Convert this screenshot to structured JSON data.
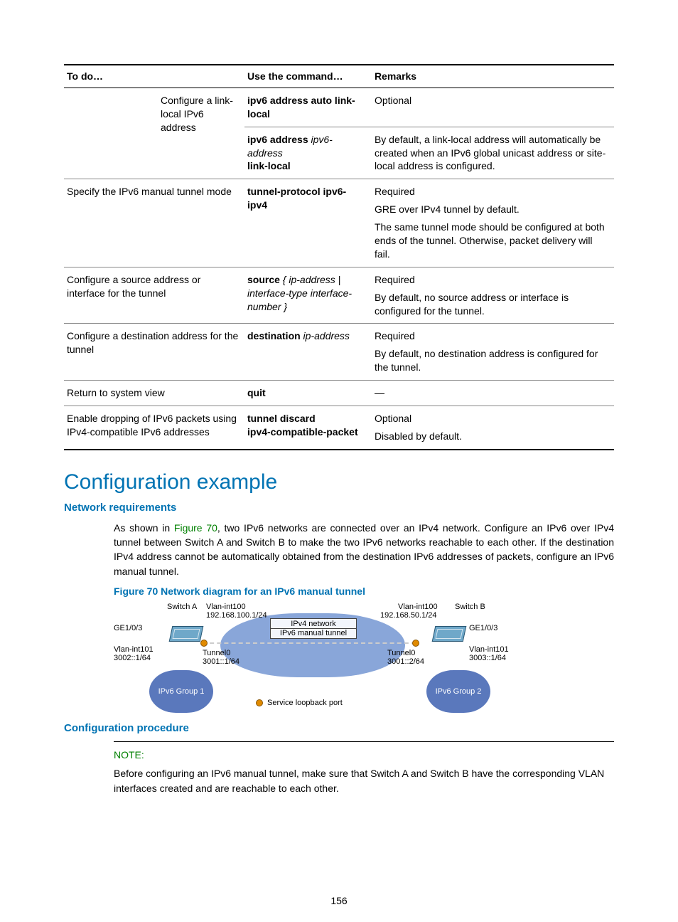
{
  "table": {
    "headers": {
      "h1": "To do…",
      "h2": "Use the command…",
      "h3": "Remarks"
    },
    "rows": {
      "r1a": {
        "todo": "Configure a link-local IPv6 address",
        "cmd": "ipv6 address auto link-local",
        "rem": "Optional"
      },
      "r1b": {
        "cmd_b": "ipv6 address",
        "cmd_i": " ipv6-address",
        "cmd_b2": " link-local",
        "rem": "By default, a link-local address will automatically be created when an IPv6 global unicast address or site-local address is configured."
      },
      "r2": {
        "todo": "Specify the IPv6 manual tunnel mode",
        "cmd": "tunnel-protocol ipv6-ipv4",
        "rem1": "Required",
        "rem2": "GRE over IPv4 tunnel by default.",
        "rem3": "The same tunnel mode should be configured at both ends of the tunnel. Otherwise, packet delivery will fail."
      },
      "r3": {
        "todo": "Configure a source address or interface for the tunnel",
        "cmd_b": "source",
        "cmd_rest": " { ip-address | interface-type interface-number }",
        "rem1": "Required",
        "rem2": "By default, no source address or interface is configured for the tunnel."
      },
      "r4": {
        "todo": "Configure a destination address for the tunnel",
        "cmd_b": "destination",
        "cmd_i": " ip-address",
        "rem1": "Required",
        "rem2": "By default, no destination address is configured for the tunnel."
      },
      "r5": {
        "todo": "Return to system view",
        "cmd": "quit",
        "rem": "—"
      },
      "r6": {
        "todo": "Enable dropping of IPv6 packets using IPv4-compatible IPv6 addresses",
        "cmd_l1": "tunnel discard",
        "cmd_l2": "ipv4-compatible-packet",
        "rem1": "Optional",
        "rem2": "Disabled by default."
      }
    }
  },
  "section": {
    "title": "Configuration example",
    "netreq_title": "Network requirements",
    "para_pre": "As shown in ",
    "para_figref": "Figure 70",
    "para_post": ", two IPv6 networks are connected over an IPv4 network. Configure an IPv6 over IPv4 tunnel between Switch A and Switch B to make the two IPv6 networks reachable to each other. If the destination IPv4 address cannot be automatically obtained from the destination IPv6 addresses of packets, configure an IPv6 manual tunnel.",
    "fig_caption": "Figure 70 Network diagram for an IPv6 manual tunnel",
    "confproc_title": "Configuration procedure",
    "note_title": "NOTE:",
    "note_body": "Before configuring an IPv6 manual tunnel, make sure that Switch A and Switch B have the corresponding VLAN interfaces created and are reachable to each other."
  },
  "diagram": {
    "switch_a": "Switch A",
    "switch_b": "Switch B",
    "vlan100a": "Vlan-int100",
    "vlan100a_ip": "192.168.100.1/24",
    "vlan100b": "Vlan-int100",
    "vlan100b_ip": "192.168.50.1/24",
    "ge_a": "GE1/0/3",
    "ge_b": "GE1/0/3",
    "vlan101a": "Vlan-int101",
    "vlan101a_ip": "3002::1/64",
    "vlan101b": "Vlan-int101",
    "vlan101b_ip": "3003::1/64",
    "tunnel0a": "Tunnel0",
    "tunnel0a_ip": "3001::1/64",
    "tunnel0b": "Tunnel0",
    "tunnel0b_ip": "3001::2/64",
    "center_top": "IPv4 network",
    "center_bot": "IPv6 manual tunnel",
    "group1": "IPv6 Group 1",
    "group2": "IPv6 Group 2",
    "legend": "Service loopback port"
  },
  "page": "156"
}
